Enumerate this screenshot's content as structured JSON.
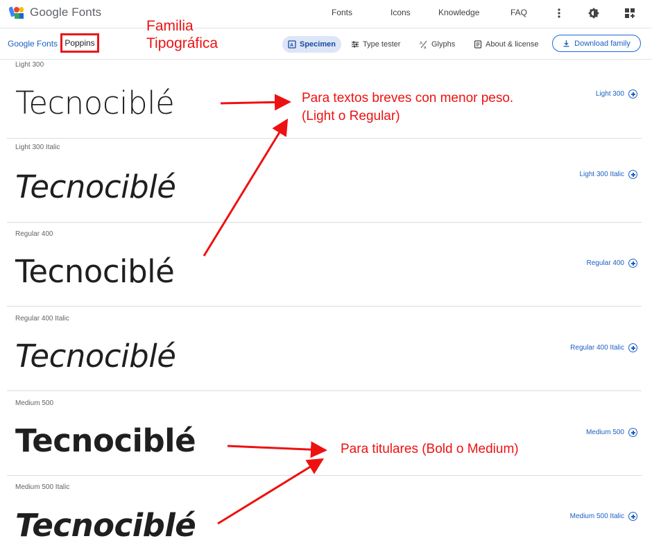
{
  "brand": {
    "name": "Google Fonts"
  },
  "nav": {
    "fonts": "Fonts",
    "icons": "Icons",
    "knowledge": "Knowledge",
    "faq": "FAQ"
  },
  "breadcrumb": {
    "home": "Google Fonts",
    "current": "Poppins"
  },
  "tabs": {
    "specimen": "Specimen",
    "type_tester": "Type tester",
    "glyphs": "Glyphs",
    "about": "About & license"
  },
  "download": {
    "label": "Download family"
  },
  "specimen_text": "Tecnociblé",
  "styles": [
    {
      "label": "Light 300",
      "action": "Light 300"
    },
    {
      "label": "Light 300 Italic",
      "action": "Light 300 Italic"
    },
    {
      "label": "Regular 400",
      "action": "Regular 400"
    },
    {
      "label": "Regular 400 Italic",
      "action": "Regular 400 Italic"
    },
    {
      "label": "Medium 500",
      "action": "Medium 500"
    },
    {
      "label": "Medium 500 Italic",
      "action": "Medium 500 Italic"
    }
  ],
  "annotations": {
    "family_line1": "Familia",
    "family_line2": "Tipográfica",
    "light_line1": "Para textos breves con menor peso.",
    "light_line2": "(Light o Regular)",
    "titles": "Para titulares (Bold o Medium)"
  },
  "colors": {
    "accent": "#1a5fc2",
    "annotation": "#ee1111"
  }
}
